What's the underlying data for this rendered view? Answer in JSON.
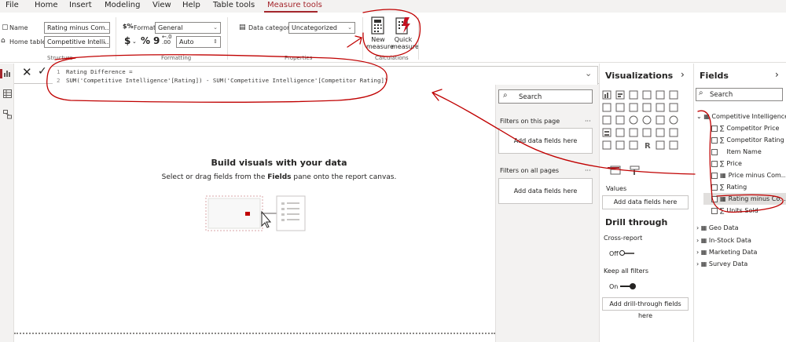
{
  "menu": {
    "tabs": [
      "File",
      "Home",
      "Insert",
      "Modeling",
      "View",
      "Help",
      "Table tools",
      "Measure tools"
    ],
    "active": "Measure tools"
  },
  "ribbon": {
    "name_label": "Name",
    "name_value": "Rating minus Com...",
    "home_table_label": "Home table",
    "home_table_value": "Competitive Intelli...",
    "structure_group": "Structure",
    "format_label": "Format",
    "format_value": "General",
    "currency_symbol": "$",
    "percent_symbol": "%",
    "comma_symbol": "9",
    "decimals_value": "Auto",
    "formatting_group": "Formatting",
    "data_category_label": "Data category",
    "data_category_value": "Uncategorized",
    "properties_group": "Properties",
    "new_measure": "New measure",
    "quick_measure": "Quick measure",
    "calculations_group": "Calculations"
  },
  "formula": {
    "line1_num": "1",
    "line1": "Rating Difference =",
    "line2_num": "2",
    "line2": "SUM('Competitive Intelligence'[Rating]) - SUM('Competitive Intelligence'[Competitor Rating])"
  },
  "canvas": {
    "title": "Build visuals with your data",
    "subtitle_pre": "Select or drag fields from the ",
    "subtitle_bold": "Fields",
    "subtitle_post": " pane onto the report canvas."
  },
  "filters": {
    "search_placeholder": "Search",
    "on_page_label": "Filters on this page",
    "on_page_add": "Add data fields here",
    "all_pages_label": "Filters on all pages",
    "all_pages_add": "Add data fields here",
    "more": "···"
  },
  "visualizations": {
    "title": "Visualizations",
    "values_label": "Values",
    "values_add": "Add data fields here",
    "drill_title": "Drill through",
    "cross_report": "Cross-report",
    "cross_report_state": "Off",
    "keep_filters": "Keep all filters",
    "keep_filters_state": "On",
    "drill_add": "Add drill-through fields here"
  },
  "fields": {
    "title": "Fields",
    "search_placeholder": "Search",
    "table_name": "Competitive Intelligence",
    "items": [
      {
        "label": "Competitor Price",
        "sigma": true
      },
      {
        "label": "Competitor Rating",
        "sigma": true
      },
      {
        "label": "Item Name",
        "sigma": false
      },
      {
        "label": "Price",
        "sigma": true
      },
      {
        "label": "Price minus Com...",
        "sigma": false,
        "calc": true
      },
      {
        "label": "Rating",
        "sigma": true
      },
      {
        "label": "Rating minus Co...",
        "sigma": false,
        "calc": true,
        "selected": true
      },
      {
        "label": "Units Sold",
        "sigma": true
      }
    ],
    "other_tables": [
      "Geo Data",
      "In-Stock Data",
      "Marketing Data",
      "Survey Data"
    ]
  },
  "colors": {
    "accent": "#a4262c",
    "annotation": "#c00000"
  }
}
